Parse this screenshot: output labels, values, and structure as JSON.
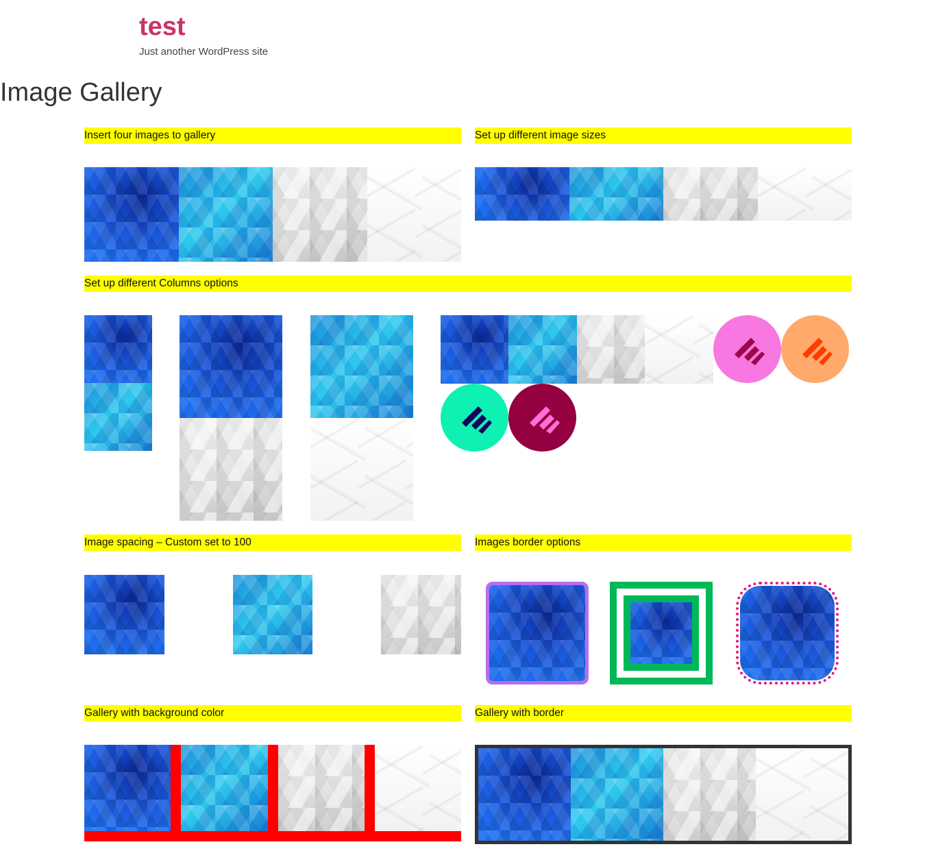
{
  "site": {
    "title": "test",
    "tagline": "Just another WordPress site"
  },
  "page": {
    "title": "Image Gallery"
  },
  "sections": {
    "insert_four": "Insert four images to gallery",
    "image_sizes": "Set up different image sizes",
    "columns": "Set up different Columns options",
    "spacing": "Image spacing – Custom set to 100",
    "border_options": "Images border options",
    "background_color": "Gallery with background color",
    "gallery_border": "Gallery with border"
  },
  "colors": {
    "site_title": "#c8336b",
    "section_bar": "#ffff00",
    "purple_border": "#b86cf0",
    "green_border": "#00b858",
    "pink_dotted": "#e8157a",
    "gallery_bg": "#ff0000",
    "gallery_border": "#333333"
  },
  "logos": [
    {
      "bg": "#f977e0",
      "fg": "#9c0849"
    },
    {
      "bg": "#ffaa6b",
      "fg": "#ff3d00"
    },
    {
      "bg": "#0ff0b3",
      "fg": "#15055e"
    },
    {
      "bg": "#940040",
      "fg": "#ff6fd8"
    }
  ]
}
